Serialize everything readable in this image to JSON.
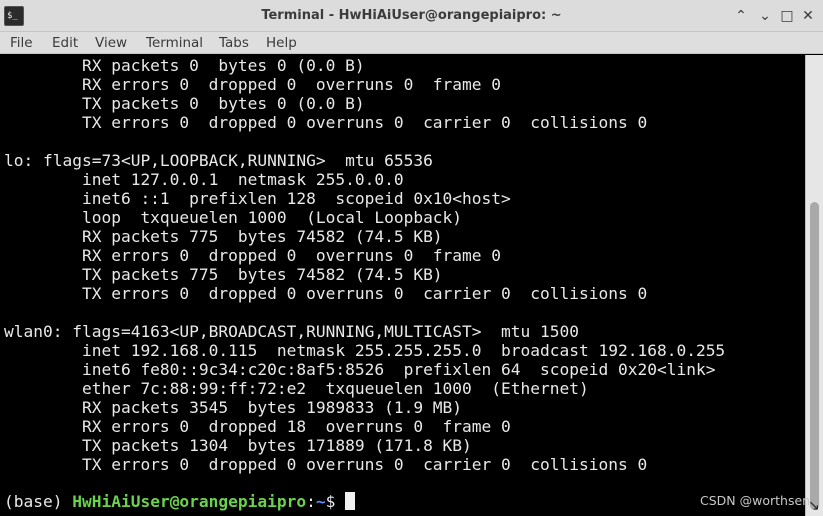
{
  "window": {
    "title": "Terminal - HwHiAiUser@orangepiaipro: ~",
    "icon_glyph": "$_",
    "controls": {
      "up": "⌃",
      "down": "⌄",
      "maximize": "□",
      "close": "✕"
    }
  },
  "menu": {
    "items": [
      "File",
      "Edit",
      "View",
      "Terminal",
      "Tabs",
      "Help"
    ]
  },
  "terminal": {
    "lines": [
      "        RX packets 0  bytes 0 (0.0 B)",
      "        RX errors 0  dropped 0  overruns 0  frame 0",
      "        TX packets 0  bytes 0 (0.0 B)",
      "        TX errors 0  dropped 0 overruns 0  carrier 0  collisions 0",
      "",
      "lo: flags=73<UP,LOOPBACK,RUNNING>  mtu 65536",
      "        inet 127.0.0.1  netmask 255.0.0.0",
      "        inet6 ::1  prefixlen 128  scopeid 0x10<host>",
      "        loop  txqueuelen 1000  (Local Loopback)",
      "        RX packets 775  bytes 74582 (74.5 KB)",
      "        RX errors 0  dropped 0  overruns 0  frame 0",
      "        TX packets 775  bytes 74582 (74.5 KB)",
      "        TX errors 0  dropped 0 overruns 0  carrier 0  collisions 0",
      "",
      "wlan0: flags=4163<UP,BROADCAST,RUNNING,MULTICAST>  mtu 1500",
      "        inet 192.168.0.115  netmask 255.255.255.0  broadcast 192.168.0.255",
      "        inet6 fe80::9c34:c20c:8af5:8526  prefixlen 64  scopeid 0x20<link>",
      "        ether 7c:88:99:ff:72:e2  txqueuelen 1000  (Ethernet)",
      "        RX packets 3545  bytes 1989833 (1.9 MB)",
      "        RX errors 0  dropped 18  overruns 0  frame 0",
      "        TX packets 1304  bytes 171889 (171.8 KB)",
      "        TX errors 0  dropped 0 overruns 0  carrier 0  collisions 0",
      ""
    ],
    "prompt": {
      "env": "(base) ",
      "user_host": "HwHiAiUser@orangepiaipro",
      "sep": ":",
      "path": "~",
      "symbol": "$ "
    }
  },
  "watermark": "CSDN @worthsen",
  "resize_grip": "↘"
}
